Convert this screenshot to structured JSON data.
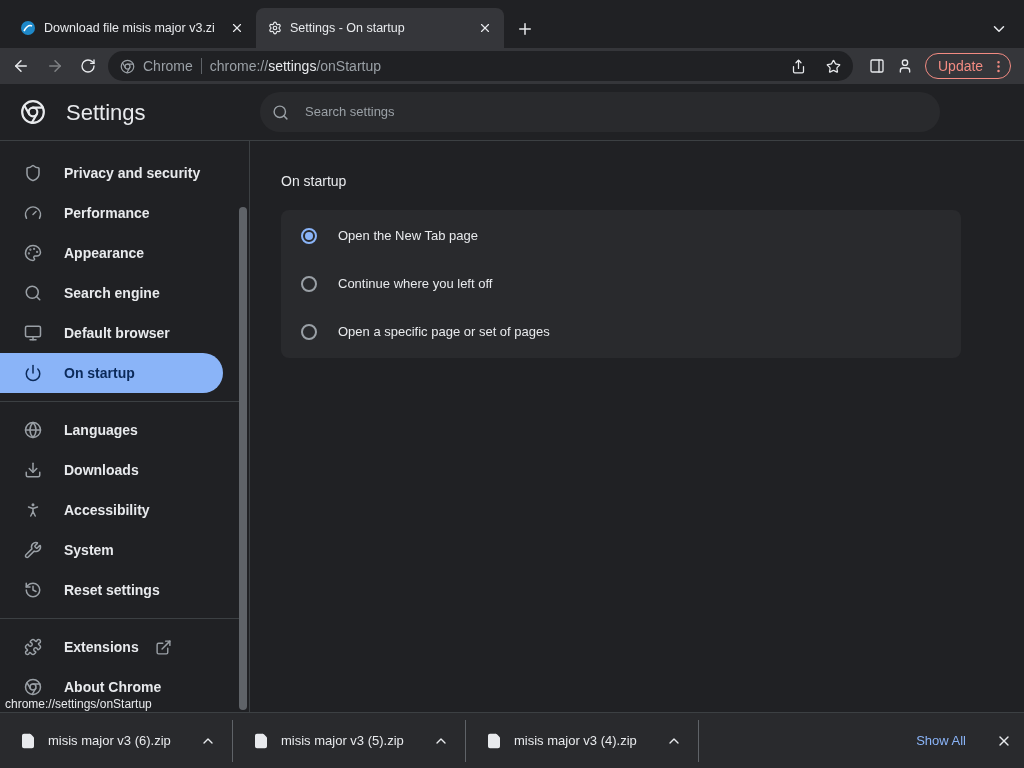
{
  "tabs": [
    {
      "title": "Download file misis major v3.zi",
      "selected": false,
      "kind": "site"
    },
    {
      "title": "Settings - On startup",
      "selected": true,
      "kind": "settings"
    }
  ],
  "toolbar": {
    "site_label": "Chrome",
    "url_scheme": "chrome://",
    "url_host": "settings",
    "url_path": "/onStartup",
    "update_label": "Update"
  },
  "header": {
    "title": "Settings",
    "search_placeholder": "Search settings"
  },
  "sidebar": {
    "groups": [
      [
        {
          "label": "Privacy and security",
          "kind": "shield",
          "selected": false
        },
        {
          "label": "Performance",
          "kind": "gauge",
          "selected": false
        },
        {
          "label": "Appearance",
          "kind": "palette",
          "selected": false
        },
        {
          "label": "Search engine",
          "kind": "search",
          "selected": false
        },
        {
          "label": "Default browser",
          "kind": "browser",
          "selected": false
        },
        {
          "label": "On startup",
          "kind": "power",
          "selected": true
        }
      ],
      [
        {
          "label": "Languages",
          "kind": "globe",
          "selected": false
        },
        {
          "label": "Downloads",
          "kind": "download",
          "selected": false
        },
        {
          "label": "Accessibility",
          "kind": "person",
          "selected": false
        },
        {
          "label": "System",
          "kind": "wrench",
          "selected": false
        },
        {
          "label": "Reset settings",
          "kind": "history",
          "selected": false
        }
      ],
      [
        {
          "label": "Extensions",
          "kind": "puzzle",
          "selected": false,
          "external": true
        },
        {
          "label": "About Chrome",
          "kind": "chrome",
          "selected": false
        }
      ]
    ]
  },
  "section": {
    "title": "On startup",
    "options": [
      {
        "label": "Open the New Tab page",
        "selected": true
      },
      {
        "label": "Continue where you left off",
        "selected": false
      },
      {
        "label": "Open a specific page or set of pages",
        "selected": false
      }
    ]
  },
  "status_bubble": "chrome://settings/onStartup",
  "downloads": {
    "items": [
      "misis major v3 (6).zip",
      "misis major v3 (5).zip",
      "misis major v3 (4).zip"
    ],
    "show_all": "Show All"
  }
}
